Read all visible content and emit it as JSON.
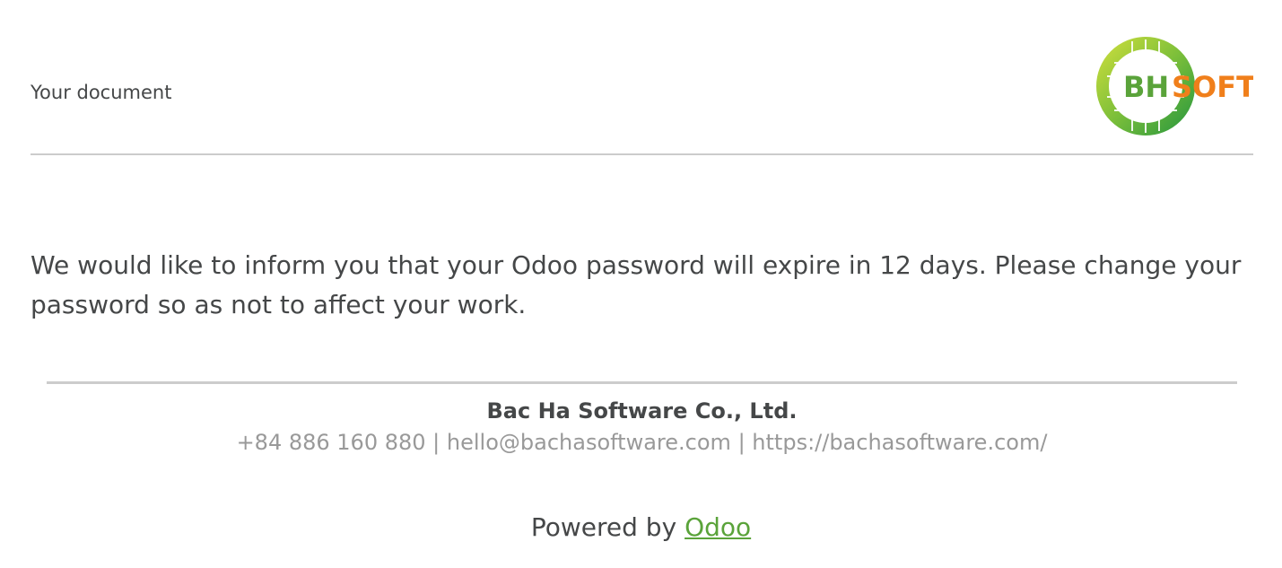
{
  "header": {
    "doc_label": "Your document",
    "logo_text_1": "BH",
    "logo_text_2": "SOFT"
  },
  "message": {
    "body": "We would like to inform you that your Odoo password will expire in 12 days. Please change your password so as not to affect your work."
  },
  "footer": {
    "company_name": "Bac Ha Software Co., Ltd.",
    "phone": "+84 886 160 880",
    "separator": "|",
    "email": "hello@bachasoftware.com",
    "website": "https://bachasoftware.com/"
  },
  "powered": {
    "prefix": "Powered by",
    "link_label": "Odoo"
  },
  "colors": {
    "logo_green": "#5aa33a",
    "logo_orange": "#f07f1b",
    "link_green": "#5aa33a",
    "text": "#454748",
    "muted": "#999999",
    "divider": "#cccccc"
  }
}
